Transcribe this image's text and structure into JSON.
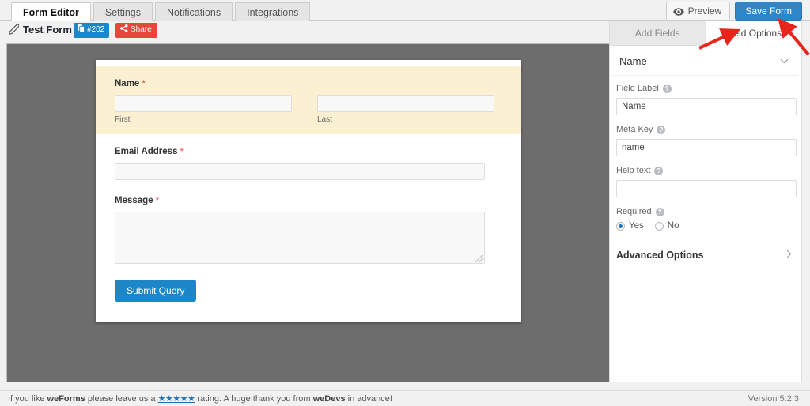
{
  "window": {
    "tabs": [
      {
        "label": "Form Editor",
        "active": true
      },
      {
        "label": "Settings",
        "active": false
      },
      {
        "label": "Notifications",
        "active": false
      },
      {
        "label": "Integrations",
        "active": false
      }
    ],
    "preview_button": "Preview",
    "save_button": "Save Form",
    "accent_blue": "#2e86c8",
    "accent_red": "#e8463a"
  },
  "titlebar": {
    "form_name": "Test Form",
    "form_id_badge": "#202",
    "share_badge": "Share",
    "pencil_icon": "pencil-icon",
    "copy_icon": "copy-icon",
    "share_icon": "share-icon"
  },
  "preview_form": {
    "fields": [
      {
        "label": "Name",
        "required_mark": "*",
        "type": "name",
        "sub_first": "First",
        "sub_last": "Last",
        "selected": true
      },
      {
        "label": "Email Address",
        "required_mark": "*",
        "type": "text",
        "selected": false
      },
      {
        "label": "Message",
        "required_mark": "*",
        "type": "textarea",
        "selected": false
      }
    ],
    "submit_label": "Submit Query"
  },
  "panel": {
    "tabs": [
      {
        "label": "Add Fields",
        "active": false
      },
      {
        "label": "Field Options",
        "active": true
      }
    ],
    "section_title": "Name",
    "section_chevron": "chevron-down-icon",
    "fields": {
      "field_label": {
        "label": "Field Label",
        "value": "Name",
        "placeholder": ""
      },
      "meta_key": {
        "label": "Meta Key",
        "value": "name",
        "placeholder": ""
      },
      "help_text": {
        "label": "Help text",
        "value": "",
        "placeholder": ""
      },
      "required": {
        "label": "Required",
        "options": [
          {
            "label": "Yes",
            "checked": true
          },
          {
            "label": "No",
            "checked": false
          }
        ]
      }
    },
    "advanced_options": {
      "title": "Advanced Options",
      "chevron": "chevron-right-icon"
    },
    "help_icon": "help-icon"
  },
  "footer": {
    "text_before": "If you like ",
    "brand1": "weForms",
    "text_mid": " please leave us a ",
    "stars": "★★★★★",
    "text_mid2": " rating. A huge thank you from ",
    "brand2": "weDevs",
    "text_after": " in advance!",
    "version": "Version 5.2.3"
  },
  "annotations": {
    "arrow_color": "#e8251a",
    "arrow_field_options": "arrow-pointing-to-field-options-tab",
    "arrow_save_form": "arrow-pointing-to-save-form-button"
  }
}
